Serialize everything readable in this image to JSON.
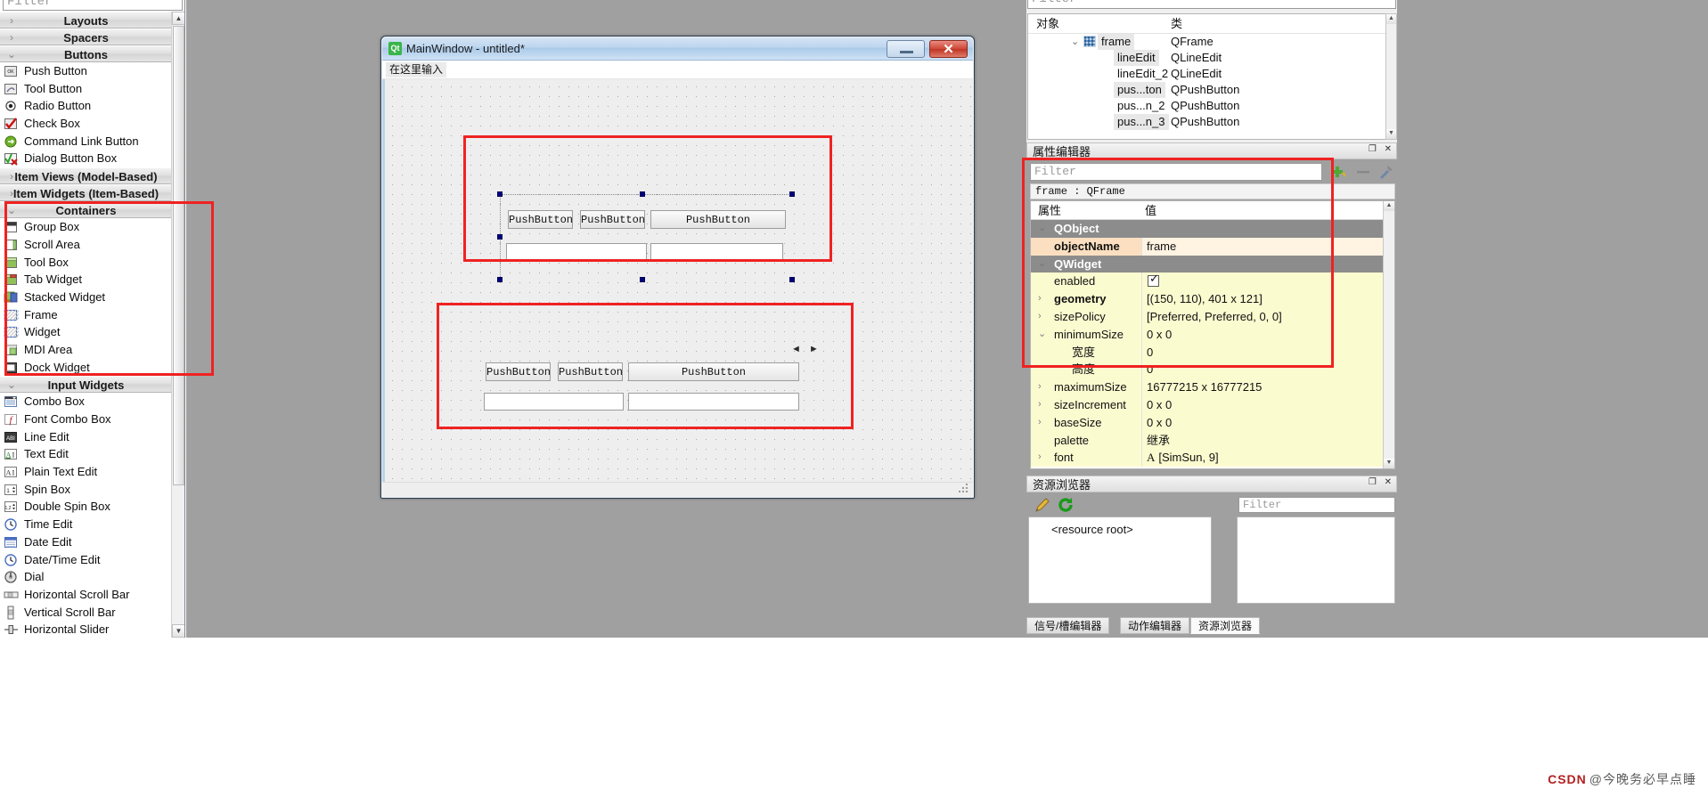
{
  "widget_box": {
    "filter_placeholder": "Filter",
    "groups": [
      {
        "label": "Layouts",
        "expanded": false,
        "items": []
      },
      {
        "label": "Spacers",
        "expanded": false,
        "items": []
      },
      {
        "label": "Buttons",
        "expanded": true,
        "items": [
          {
            "label": "Push Button",
            "icon": "push-button-icon"
          },
          {
            "label": "Tool Button",
            "icon": "tool-button-icon"
          },
          {
            "label": "Radio Button",
            "icon": "radio-button-icon"
          },
          {
            "label": "Check Box",
            "icon": "check-box-icon"
          },
          {
            "label": "Command Link Button",
            "icon": "command-link-button-icon"
          },
          {
            "label": "Dialog Button Box",
            "icon": "dialog-button-box-icon"
          }
        ]
      },
      {
        "label": "Item Views (Model-Based)",
        "expanded": false,
        "items": []
      },
      {
        "label": "Item Widgets (Item-Based)",
        "expanded": false,
        "items": []
      },
      {
        "label": "Containers",
        "expanded": true,
        "items": [
          {
            "label": "Group Box",
            "icon": "group-box-icon"
          },
          {
            "label": "Scroll Area",
            "icon": "scroll-area-icon"
          },
          {
            "label": "Tool Box",
            "icon": "tool-box-icon"
          },
          {
            "label": "Tab Widget",
            "icon": "tab-widget-icon"
          },
          {
            "label": "Stacked Widget",
            "icon": "stacked-widget-icon"
          },
          {
            "label": "Frame",
            "icon": "frame-icon"
          },
          {
            "label": "Widget",
            "icon": "widget-icon"
          },
          {
            "label": "MDI Area",
            "icon": "mdi-area-icon"
          },
          {
            "label": "Dock Widget",
            "icon": "dock-widget-icon"
          }
        ]
      },
      {
        "label": "Input Widgets",
        "expanded": true,
        "items": [
          {
            "label": "Combo Box",
            "icon": "combo-box-icon"
          },
          {
            "label": "Font Combo Box",
            "icon": "font-combo-box-icon"
          },
          {
            "label": "Line Edit",
            "icon": "line-edit-icon"
          },
          {
            "label": "Text Edit",
            "icon": "text-edit-icon"
          },
          {
            "label": "Plain Text Edit",
            "icon": "plain-text-edit-icon"
          },
          {
            "label": "Spin Box",
            "icon": "spin-box-icon"
          },
          {
            "label": "Double Spin Box",
            "icon": "double-spin-box-icon"
          },
          {
            "label": "Time Edit",
            "icon": "time-edit-icon"
          },
          {
            "label": "Date Edit",
            "icon": "date-edit-icon"
          },
          {
            "label": "Date/Time Edit",
            "icon": "date-time-edit-icon"
          },
          {
            "label": "Dial",
            "icon": "dial-icon"
          },
          {
            "label": "Horizontal Scroll Bar",
            "icon": "horizontal-scroll-bar-icon"
          },
          {
            "label": "Vertical Scroll Bar",
            "icon": "vertical-scroll-bar-icon"
          },
          {
            "label": "Horizontal Slider",
            "icon": "horizontal-slider-icon"
          }
        ]
      }
    ]
  },
  "main_window": {
    "title": "MainWindow - untitled*",
    "logo_text": "Qt",
    "menu_placeholder": "在这里输入",
    "minimize_label": "Minimize",
    "close_label": "Close",
    "frame1": {
      "buttons": [
        "PushButton",
        "PushButton",
        "PushButton"
      ],
      "line_edits": [
        "",
        ""
      ]
    },
    "frame2": {
      "buttons": [
        "PushButton",
        "PushButton",
        "PushButton"
      ],
      "line_edits": [
        "",
        ""
      ]
    },
    "resize_hint": "◄ ►"
  },
  "object_inspector": {
    "filter_placeholder": "Filter",
    "columns": [
      "对象",
      "类"
    ],
    "rows": [
      {
        "name": "frame",
        "cls": "QFrame",
        "indent": 78,
        "expander": "v",
        "has_icon": true,
        "highlight": true
      },
      {
        "name": "lineEdit",
        "cls": "QLineEdit",
        "indent": 96,
        "expander": "",
        "has_icon": false,
        "highlight": true
      },
      {
        "name": "lineEdit_2",
        "cls": "QLineEdit",
        "indent": 96,
        "expander": "",
        "has_icon": false,
        "highlight": false
      },
      {
        "name": "pus...ton",
        "cls": "QPushButton",
        "indent": 96,
        "expander": "",
        "has_icon": false,
        "highlight": true
      },
      {
        "name": "pus...n_2",
        "cls": "QPushButton",
        "indent": 96,
        "expander": "",
        "has_icon": false,
        "highlight": false
      },
      {
        "name": "pus...n_3",
        "cls": "QPushButton",
        "indent": 96,
        "expander": "",
        "has_icon": false,
        "highlight": true
      }
    ]
  },
  "property_editor": {
    "title": "属性编辑器",
    "filter_placeholder": "Filter",
    "selected_object": "frame : QFrame",
    "columns": [
      "属性",
      "值"
    ],
    "rows": [
      {
        "kind": "group",
        "name": "QObject",
        "value": "",
        "expander": "v"
      },
      {
        "kind": "orange",
        "name": "objectName",
        "value": "frame",
        "expander": ""
      },
      {
        "kind": "group",
        "name": "QWidget",
        "value": "",
        "expander": "v"
      },
      {
        "kind": "check",
        "name": "enabled",
        "value": "",
        "expander": ""
      },
      {
        "kind": "bold",
        "name": "geometry",
        "value": "[(150, 110), 401 x 121]",
        "expander": ">"
      },
      {
        "kind": "plain",
        "name": "sizePolicy",
        "value": "[Preferred, Preferred, 0, 0]",
        "expander": ">"
      },
      {
        "kind": "plain",
        "name": "minimumSize",
        "value": "0 x 0",
        "expander": "v"
      },
      {
        "kind": "sub",
        "name": "宽度",
        "value": "0",
        "expander": ""
      },
      {
        "kind": "sub",
        "name": "高度",
        "value": "0",
        "expander": ""
      },
      {
        "kind": "plain",
        "name": "maximumSize",
        "value": "16777215 x 16777215",
        "expander": ">"
      },
      {
        "kind": "plain",
        "name": "sizeIncrement",
        "value": "0 x 0",
        "expander": ">"
      },
      {
        "kind": "plain",
        "name": "baseSize",
        "value": "0 x 0",
        "expander": ">"
      },
      {
        "kind": "plain",
        "name": "palette",
        "value": "继承",
        "expander": ""
      },
      {
        "kind": "font",
        "name": "font",
        "value": "[SimSun, 9]",
        "expander": ">"
      }
    ]
  },
  "resource_browser": {
    "title": "资源浏览器",
    "filter_placeholder": "Filter",
    "root_label": "<resource root>",
    "edit_icon": "pencil-icon",
    "reload_icon": "refresh-icon"
  },
  "bottom_tabs": [
    {
      "label": "信号/槽编辑器",
      "active": false
    },
    {
      "label": "动作编辑器",
      "active": false
    },
    {
      "label": "资源浏览器",
      "active": true
    }
  ],
  "watermark": {
    "brand": "CSDN",
    "text": "@今晚务必早点睡"
  },
  "colors": {
    "accent_red": "#ef2222",
    "selection_handle": "#00007c",
    "canvas_bg": "#a0a0a0",
    "title_blue": "#bdd6ef",
    "close_red": "#cf4a3a"
  }
}
